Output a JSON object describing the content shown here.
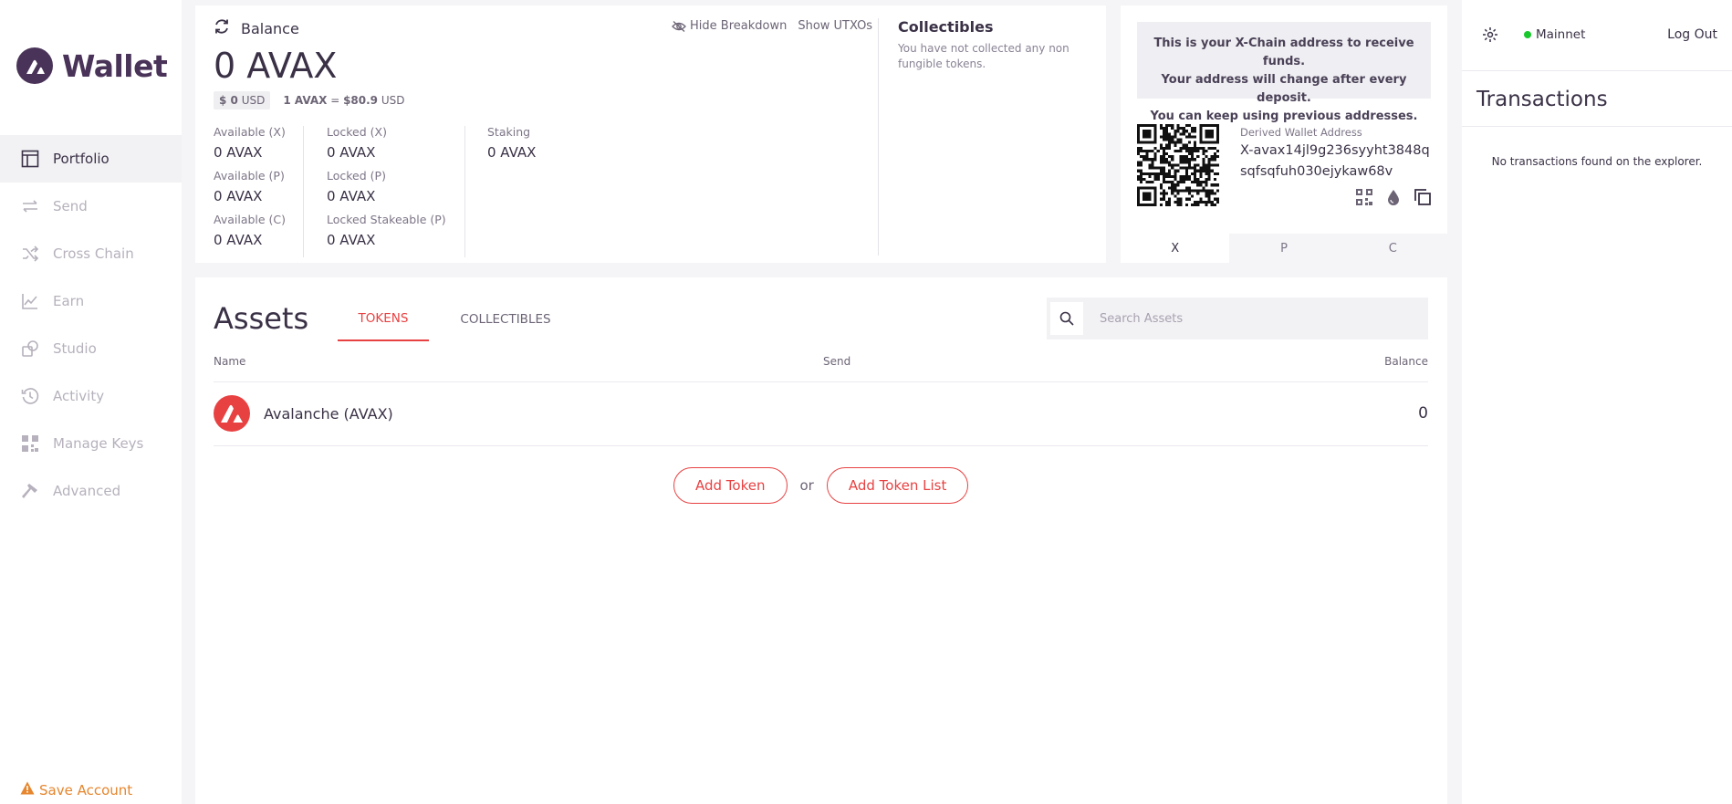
{
  "sidebar": {
    "logo_text": "Wallet",
    "items": [
      {
        "label": "Portfolio",
        "icon": "portfolio-icon"
      },
      {
        "label": "Send",
        "icon": "transfer-arrows-icon"
      },
      {
        "label": "Cross Chain",
        "icon": "shuffle-icon"
      },
      {
        "label": "Earn",
        "icon": "chart-line-icon"
      },
      {
        "label": "Studio",
        "icon": "studio-icon"
      },
      {
        "label": "Activity",
        "icon": "history-icon"
      },
      {
        "label": "Manage Keys",
        "icon": "keys-grid-icon"
      },
      {
        "label": "Advanced",
        "icon": "hammer-icon"
      }
    ],
    "save_account": "Save Account"
  },
  "balance": {
    "header": "Balance",
    "amount": "0 AVAX",
    "usd_value": "$ 0",
    "usd_unit": "USD",
    "rate_left": "1 AVAX",
    "rate_eq": " = ",
    "rate_right": "$80.9",
    "rate_unit": " USD",
    "hide_breakdown": "Hide Breakdown",
    "show_utxos": "Show UTXOs",
    "available_x_label": "Available (X)",
    "available_x_value": "0 AVAX",
    "available_p_label": "Available (P)",
    "available_p_value": "0 AVAX",
    "available_c_label": "Available (C)",
    "available_c_value": "0 AVAX",
    "locked_x_label": "Locked (X)",
    "locked_x_value": "0 AVAX",
    "locked_p_label": "Locked (P)",
    "locked_p_value": "0 AVAX",
    "locked_stakeable_label": "Locked Stakeable (P)",
    "locked_stakeable_value": "0 AVAX",
    "staking_label": "Staking",
    "staking_value": "0 AVAX"
  },
  "collectibles": {
    "title": "Collectibles",
    "empty_text": "You have not collected any non fungible tokens."
  },
  "address": {
    "note_line1": "This is your X-Chain address to receive funds.",
    "note_line2": "Your address will change after every deposit.",
    "note_line3": "You can keep using previous addresses.",
    "label": "Derived Wallet Address",
    "value": "X-avax14jl9g236syyht3848qsqfsqfuh030ejykaw68v",
    "chain_tabs": [
      "X",
      "P",
      "C"
    ],
    "active_chain": "X"
  },
  "assets": {
    "title": "Assets",
    "tab_tokens": "TOKENS",
    "tab_collectibles": "COLLECTIBLES",
    "search_placeholder": "Search Assets",
    "col_name": "Name",
    "col_send": "Send",
    "col_balance": "Balance",
    "rows": [
      {
        "name": "Avalanche (AVAX)",
        "balance": "0"
      }
    ],
    "add_token": "Add Token",
    "or": "or",
    "add_token_list": "Add Token List"
  },
  "right_panel": {
    "network": "Mainnet",
    "logout": "Log Out",
    "tx_title": "Transactions",
    "tx_empty": "No transactions found on the explorer."
  },
  "colors": {
    "accent_red": "#e84142",
    "brand_purple": "#4a3358",
    "warning_orange": "#e6862e",
    "status_green": "#18c82c"
  }
}
